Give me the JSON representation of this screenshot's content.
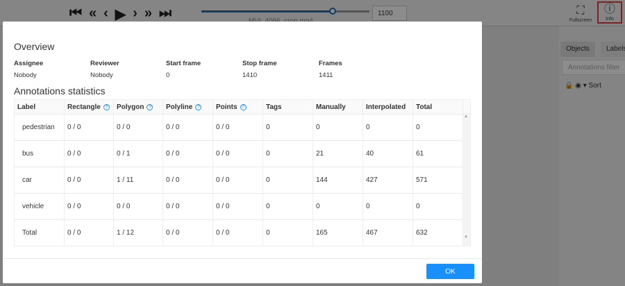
{
  "player": {
    "frame": "1100",
    "filename": "MVI_4066_crop.mp4",
    "progress": 0.78
  },
  "header": {
    "fullscreen": "Fullscreen",
    "info": "Info"
  },
  "sidebar": {
    "tabs": [
      "Objects",
      "Labels"
    ],
    "filter_placeholder": "Annotations filter",
    "sort": "Sort"
  },
  "modal": {
    "overview_title": "Overview",
    "overview": [
      {
        "k": "Assignee",
        "v": "Nobody"
      },
      {
        "k": "Reviewer",
        "v": "Nobody"
      },
      {
        "k": "Start frame",
        "v": "0"
      },
      {
        "k": "Stop frame",
        "v": "1410"
      },
      {
        "k": "Frames",
        "v": "1411"
      }
    ],
    "stats_title": "Annotations statistics",
    "columns": [
      "Label",
      "Rectangle",
      "Polygon",
      "Polyline",
      "Points",
      "Tags",
      "Manually",
      "Interpolated",
      "Total"
    ],
    "rows": [
      [
        "pedestrian",
        "0 / 0",
        "0 / 0",
        "0 / 0",
        "0 / 0",
        "0",
        "0",
        "0",
        "0"
      ],
      [
        "bus",
        "0 / 0",
        "0 / 1",
        "0 / 0",
        "0 / 0",
        "0",
        "21",
        "40",
        "61"
      ],
      [
        "car",
        "0 / 0",
        "1 / 11",
        "0 / 0",
        "0 / 0",
        "0",
        "144",
        "427",
        "571"
      ],
      [
        "vehicle",
        "0 / 0",
        "0 / 0",
        "0 / 0",
        "0 / 0",
        "0",
        "0",
        "0",
        "0"
      ],
      [
        "Total",
        "0 / 0",
        "1 / 12",
        "0 / 0",
        "0 / 0",
        "0",
        "165",
        "467",
        "632"
      ]
    ],
    "ok": "OK"
  }
}
